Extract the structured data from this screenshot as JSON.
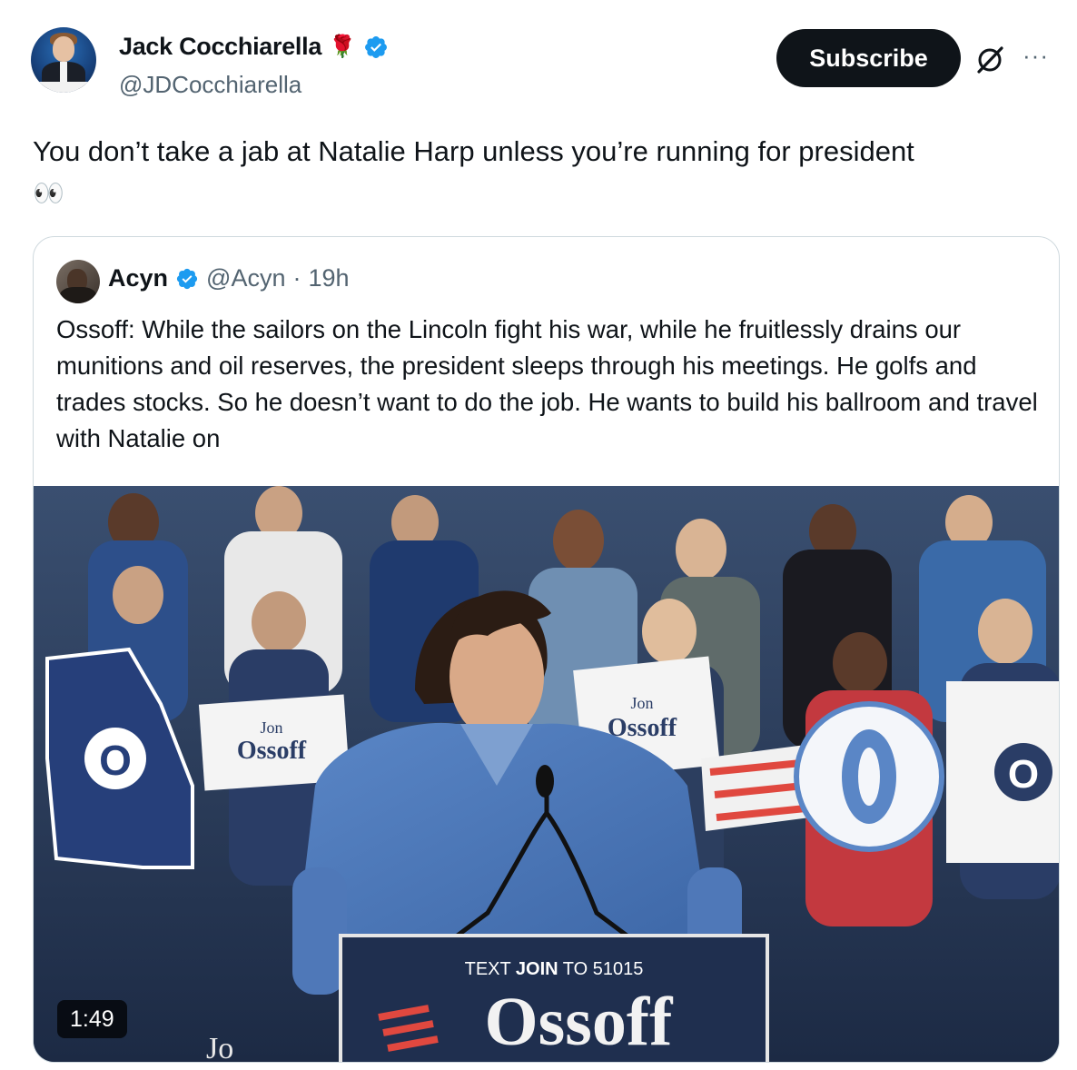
{
  "author": {
    "display_name": "Jack Cocchiarella",
    "name_emoji": "🌹",
    "handle": "@JDCocchiarella",
    "verified_icon": "verified-badge-icon"
  },
  "actions": {
    "subscribe_label": "Subscribe",
    "grok_icon": "grok-icon",
    "more_label": "···"
  },
  "tweet": {
    "text": "You don’t take a jab at Natalie Harp unless you’re running for president",
    "emoji": "👀"
  },
  "quoted": {
    "name": "Acyn",
    "handle": "@Acyn",
    "separator": "·",
    "time": "19h",
    "text": "Ossoff: While the sailors on the Lincoln fight his war, while he fruitlessly drains our munitions and oil reserves, the president sleeps through his meetings. He golfs and trades stocks. So he doesn’t want to do the job. He wants to build his ballroom and travel with Natalie on",
    "video": {
      "duration": "1:49",
      "podium_line1_a": "TEXT ",
      "podium_line1_b": "JOIN",
      "podium_line1_c": " TO 51015",
      "podium_brand": "Ossoff",
      "sign_brand": "Ossoff",
      "sign_top": "Jon",
      "circle_letter": "O",
      "partial_text": "Jo"
    }
  },
  "colors": {
    "verified_blue": "#1d9bf0",
    "text_primary": "#0f1419",
    "text_secondary": "#536471",
    "border": "#cfd9de",
    "podium_navy": "#1f2f4f",
    "accent_red": "#e0483f"
  }
}
